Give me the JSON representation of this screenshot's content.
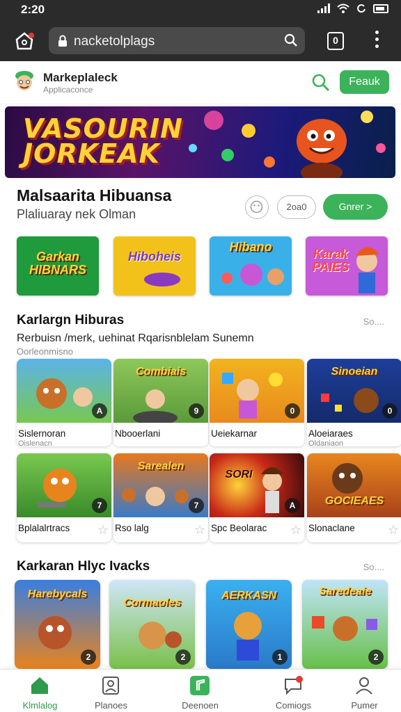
{
  "status_bar": {
    "time": "2:20"
  },
  "browser": {
    "url": "nacketolplags",
    "tabs_count": "0"
  },
  "app_header": {
    "title": "Markeplaleck",
    "subtitle": "Applicaconce",
    "button_label": "Feauk"
  },
  "banner": {
    "text": "VASOURIN JORKEAK"
  },
  "section_featured": {
    "title": "Malsaarita Hibuansa",
    "subtitle": "Plaliuaray nek Olman",
    "pill_label": "2oa0",
    "cta_label": "Gnrer >",
    "tiles": [
      {
        "label": "Garkan HIBNARS",
        "color": "#1f9a3c"
      },
      {
        "label": "Hiboheis",
        "color": "#f2c21a"
      },
      {
        "label": "Hibano",
        "color": "#3ab0e8"
      },
      {
        "label": "Karak PAIES",
        "color": "#c65ad8"
      }
    ]
  },
  "section_games": {
    "title": "Karlargn Hiburas",
    "more_label": "So....",
    "description": "Rerbuisn /merk, uehinat Rqarisnblelam Sunemn",
    "description2": "Oorleonmisno",
    "cards": [
      {
        "thumb_text": "",
        "badge": "A",
        "name": "Sislernoran",
        "sub": "Oislenacn",
        "color": "#5bb3e8"
      },
      {
        "thumb_text": "Combiais",
        "badge": "9",
        "name": "Nbooerlani",
        "sub": "",
        "color": "#8ec85a"
      },
      {
        "thumb_text": "",
        "badge": "0",
        "name": "Ueiekarnar",
        "sub": "",
        "color": "#f2b31e"
      },
      {
        "thumb_text": "Sinoeian",
        "badge": "0",
        "name": "Aloeiaraes",
        "sub": "Oldaniaon",
        "color": "#1e3e9a"
      },
      {
        "thumb_text": "",
        "badge": "7",
        "name": "Bplalalrtracs",
        "sub": "",
        "color": "#58b848"
      },
      {
        "thumb_text": "Sarealen",
        "badge": "7",
        "name": "Rso lalg",
        "sub": "",
        "color": "#e8781e"
      },
      {
        "thumb_text": "SORI",
        "badge": "A",
        "name": "Spc Beolarac",
        "sub": "",
        "color": "#c82818"
      },
      {
        "thumb_text": "GOCIEAES",
        "badge": "",
        "name": "Slonaclane",
        "sub": "",
        "color": "#e8861e"
      }
    ]
  },
  "section_bottom": {
    "title": "Karkaran Hlyc Ivacks",
    "more_label": "So....",
    "cards": [
      {
        "thumb_text": "Harebycals",
        "badge": "2",
        "color": "#3a7ee0"
      },
      {
        "thumb_text": "Cormaoles",
        "badge": "2",
        "color": "#7ac04a"
      },
      {
        "thumb_text": "AERKASN",
        "badge": "1",
        "color": "#3ab0f0"
      },
      {
        "thumb_text": "Saredeaie",
        "badge": "2",
        "color": "#68c04a"
      }
    ]
  },
  "bottom_nav": {
    "items": [
      {
        "label": "Klmlalog",
        "icon": "home-icon"
      },
      {
        "label": "Planoes",
        "icon": "portrait-icon"
      },
      {
        "label": "Deenoen",
        "icon": "music-icon"
      },
      {
        "label": "Comiogs",
        "icon": "chat-icon"
      },
      {
        "label": "Pumer",
        "icon": "user-icon"
      }
    ]
  }
}
